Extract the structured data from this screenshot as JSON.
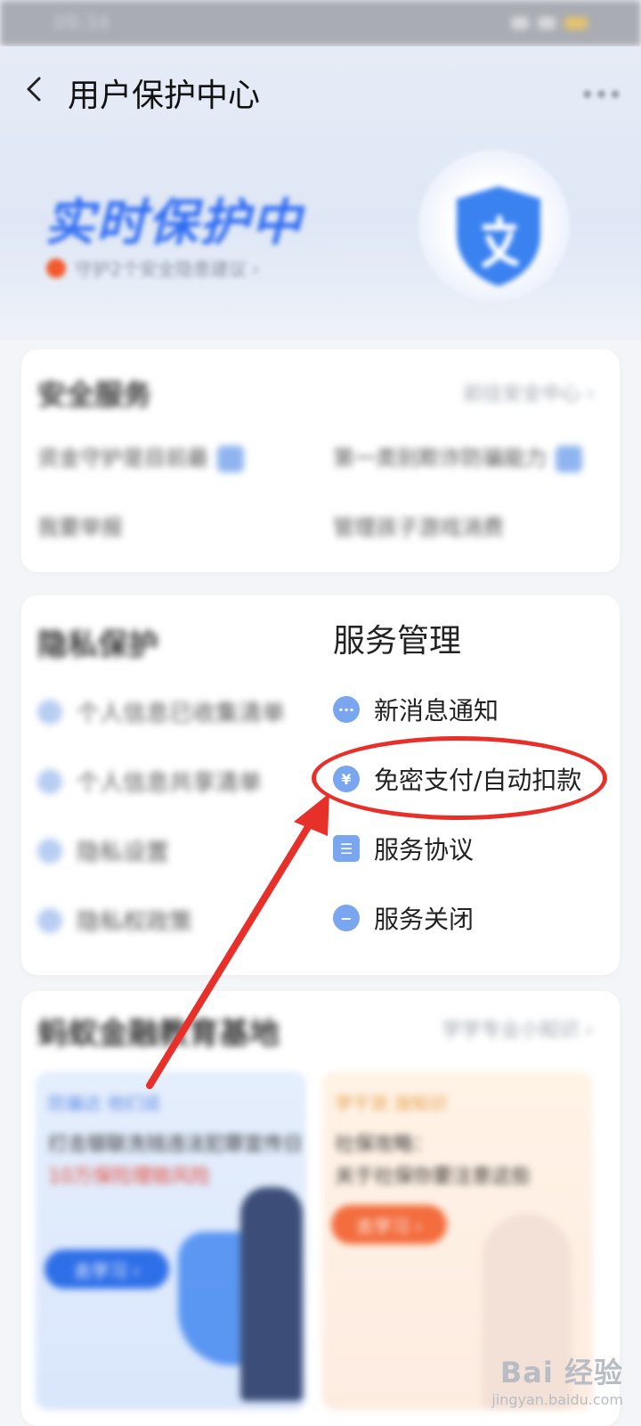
{
  "status_bar": {
    "time": "09:34"
  },
  "nav": {
    "title": "用户保护中心",
    "back_icon": "chevron-left-icon",
    "more_icon": "more-icon"
  },
  "hero": {
    "title": "实时保护中",
    "subtitle": "守护2个安全隐患建议 ›",
    "shield_icon": "shield-icon"
  },
  "security": {
    "header": "安全服务",
    "link": "前往安全中心 ›",
    "items": [
      {
        "label": "资金守护是目前最"
      },
      {
        "label": "第一类别欺诈防骗能力"
      },
      {
        "label": "我要举报"
      },
      {
        "label": "管理孩子游戏消费"
      }
    ]
  },
  "privacy": {
    "header": "隐私保护",
    "items": [
      {
        "label": "个人信息已收集清单"
      },
      {
        "label": "个人信息共享清单"
      },
      {
        "label": "隐私设置"
      },
      {
        "label": "隐私权政策"
      }
    ]
  },
  "service_management": {
    "title": "服务管理",
    "items": [
      {
        "label": "新消息通知",
        "icon": "chat-bubble-icon",
        "glyph": "···"
      },
      {
        "label": "免密支付/自动扣款",
        "icon": "yuan-icon",
        "glyph": "¥"
      },
      {
        "label": "服务协议",
        "icon": "document-icon",
        "glyph": "☰"
      },
      {
        "label": "服务关闭",
        "icon": "minus-circle-icon",
        "glyph": "−"
      }
    ]
  },
  "education": {
    "header": "蚂蚁金融教育基地",
    "link": "学学专业小知识 ›",
    "left_card": {
      "tag": "防骗达 他们说",
      "line1": "打击银联洗钱违法犯罪宣传日",
      "line2": "10万保险理赔风险",
      "button": "去学习 ›"
    },
    "right_card": {
      "tag": "学干货 涨知识",
      "line1": "社保攻略：",
      "line2": "关于社保你要注意这些",
      "button": "去学习 ›"
    }
  },
  "watermark": {
    "main": "Bai 经验",
    "sub": "jingyan.baidu.com"
  },
  "colors": {
    "accent_blue": "#2f6cf2",
    "annotation_red": "#e8302a",
    "menu_icon_blue": "#79a6ee"
  }
}
